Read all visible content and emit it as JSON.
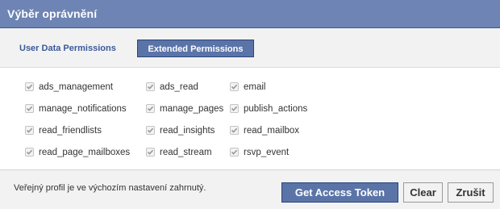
{
  "dialog": {
    "title": "Výběr oprávnění"
  },
  "tabs": [
    {
      "label": "User Data Permissions",
      "selected": false
    },
    {
      "label": "Extended Permissions",
      "selected": true
    }
  ],
  "permissions": [
    {
      "label": "ads_management",
      "checked": true,
      "disabled": true
    },
    {
      "label": "ads_read",
      "checked": true,
      "disabled": true
    },
    {
      "label": "email",
      "checked": true,
      "disabled": true
    },
    {
      "label": "manage_notifications",
      "checked": true,
      "disabled": true
    },
    {
      "label": "manage_pages",
      "checked": true,
      "disabled": true
    },
    {
      "label": "publish_actions",
      "checked": true,
      "disabled": true
    },
    {
      "label": "read_friendlists",
      "checked": true,
      "disabled": true
    },
    {
      "label": "read_insights",
      "checked": true,
      "disabled": true
    },
    {
      "label": "read_mailbox",
      "checked": true,
      "disabled": true
    },
    {
      "label": "read_page_mailboxes",
      "checked": true,
      "disabled": true
    },
    {
      "label": "read_stream",
      "checked": true,
      "disabled": true
    },
    {
      "label": "rsvp_event",
      "checked": true,
      "disabled": true
    }
  ],
  "footer": {
    "note": "Veřejný profil je ve výchozím nastavení zahrnutý.",
    "get_token_label": "Get Access Token",
    "clear_label": "Clear",
    "cancel_label": "Zrušit"
  },
  "colors": {
    "title_bar": "#6d84b4",
    "primary_button": "#5b74a8",
    "link_text": "#3b5998",
    "panel_background": "#f2f2f2"
  },
  "icons": {
    "checkbox": "check-icon"
  }
}
